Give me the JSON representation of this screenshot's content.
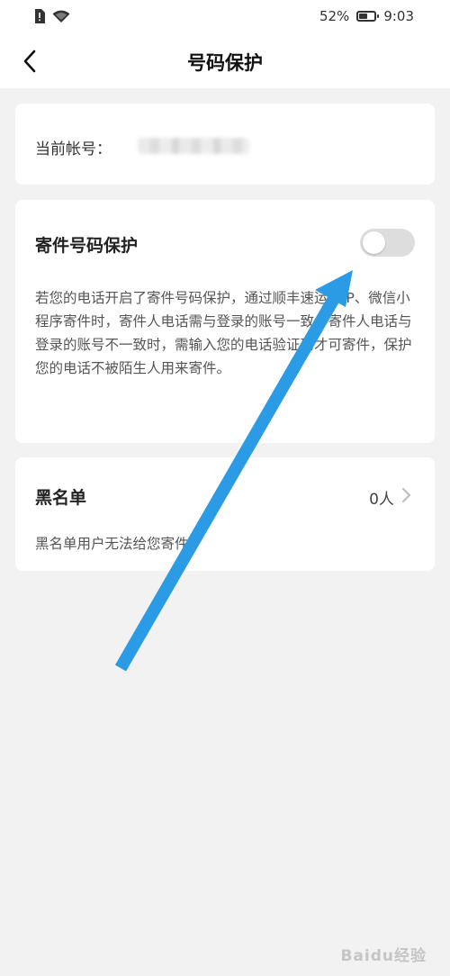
{
  "status": {
    "battery_percent": "52%",
    "battery_level": 0.52,
    "time": "9:03"
  },
  "nav": {
    "title": "号码保护",
    "back_icon": "chevron-left-icon"
  },
  "account": {
    "label": "当前帐号："
  },
  "protect": {
    "title": "寄件号码保护",
    "toggle_on": false,
    "description": "若您的电话开启了寄件号码保护，通过顺丰速运APP、微信小程序寄件时，寄件人电话需与登录的账号一致。寄件人电话与登录的账号不一致时，需输入您的电话验证码才可寄件，保护您的电话不被陌生人用来寄件。"
  },
  "blacklist": {
    "title": "黑名单",
    "count": "0人",
    "description": "黑名单用户无法给您寄件。"
  },
  "annotation": {
    "color": "#2b9be6"
  },
  "watermark": {
    "text": "Baidu经验"
  }
}
